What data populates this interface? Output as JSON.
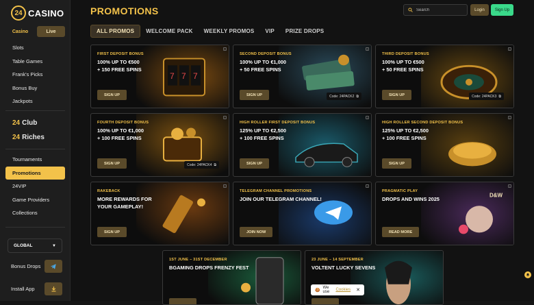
{
  "brand": {
    "logo_num": "24",
    "logo_text": "CASINO"
  },
  "modes": {
    "casino": "Casino",
    "live": "Live"
  },
  "nav_top": [
    "Slots",
    "Table Games",
    "Frank's Picks",
    "Bonus Buy",
    "Jackpots"
  ],
  "clubs": [
    {
      "num": "24",
      "name": "Club"
    },
    {
      "num": "24",
      "name": "Riches"
    }
  ],
  "nav_bottom": [
    "Tournaments",
    "Promotions",
    "24VIP",
    "Game Providers",
    "Collections"
  ],
  "active_nav": "Promotions",
  "language": "GLOBAL",
  "side_actions": {
    "bonus_drops": "Bonus Drops",
    "install_app": "Install App"
  },
  "header": {
    "title": "PROMOTIONS",
    "search_placeholder": "Search",
    "login": "Login",
    "signup": "Sign Up"
  },
  "tabs": [
    "ALL PROMOS",
    "WELCOME PACK",
    "WEEKLY PROMOS",
    "VIP",
    "PRIZE DROPS"
  ],
  "cards": [
    {
      "cat": "FIRST DEPOSIT BONUS",
      "l1": "100% UP TO €500",
      "l2": "+ 150 FREE SPINS",
      "btn": "SIGN UP",
      "code": ""
    },
    {
      "cat": "SECOND DEPOSIT BONUS",
      "l1": "100% UP TO €1,000",
      "l2": "+ 50 FREE SPINS",
      "btn": "SIGN UP",
      "code": "Code: 24PACK2"
    },
    {
      "cat": "THIRD DEPOSIT BONUS",
      "l1": "100% UP TO €500",
      "l2": "+ 50 FREE SPINS",
      "btn": "SIGN UP",
      "code": "Code: 24PACK3"
    },
    {
      "cat": "FOURTH DEPOSIT BONUS",
      "l1": "100% UP TO €1,000",
      "l2": "+ 100 FREE SPINS",
      "btn": "SIGN UP",
      "code": "Code: 24PACK4"
    },
    {
      "cat": "HIGH ROLLER FIRST DEPOSIT BONUS",
      "l1": "125% UP TO €2,500",
      "l2": "+ 100 FREE SPINS",
      "btn": "SIGN UP",
      "code": ""
    },
    {
      "cat": "HIGH ROLLER SECOND DEPOSIT BONUS",
      "l1": "125% UP TO €2,500",
      "l2": "+ 100 FREE SPINS",
      "btn": "SIGN UP",
      "code": ""
    },
    {
      "cat": "RAKEBACK",
      "l1": "MORE REWARDS FOR",
      "l2": "YOUR GAMEPLAY!",
      "btn": "SIGN UP",
      "code": ""
    },
    {
      "cat": "TELEGRAM CHANNEL PROMOTIONS",
      "l1": "JOIN OUR TELEGRAM CHANNEL!",
      "l2": "",
      "btn": "JOIN NOW",
      "code": ""
    },
    {
      "cat": "PRAGMATIC PLAY",
      "l1": "DROPS AND WINS 2025",
      "l2": "",
      "btn": "READ MORE",
      "code": ""
    },
    {
      "cat": "1ST JUNE – 31ST DECEMBER",
      "l1": "BGAMING DROPS FRENZY FEST",
      "l2": "",
      "btn": "",
      "code": ""
    },
    {
      "cat": "23 JUNE – 14 SEPTEMBER",
      "l1": "VOLTENT LUCKY SEVENS",
      "l2": "",
      "btn": "",
      "code": ""
    }
  ],
  "cookie": {
    "text": "We use",
    "link": "Cookies"
  },
  "colors": {
    "accent": "#f3c24a",
    "signup": "#3ad98a",
    "button_bg": "#5a4a2a"
  }
}
